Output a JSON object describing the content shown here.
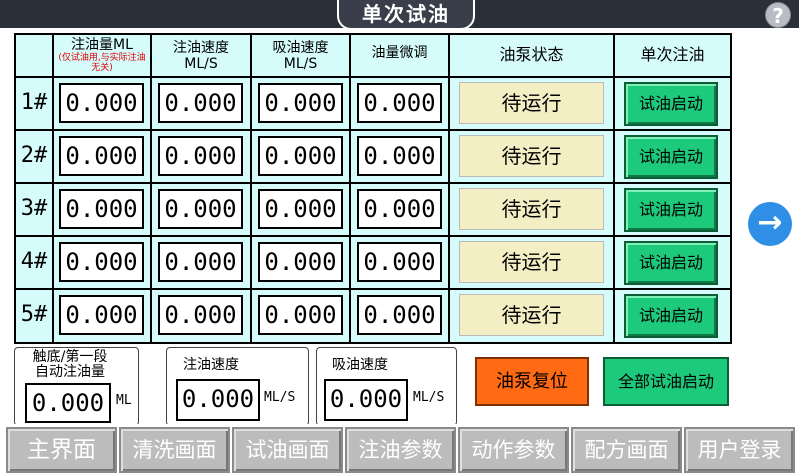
{
  "title": "单次试油",
  "help_label": "?",
  "headers": {
    "inject_amount": "注油量ML",
    "inject_amount_note": "(仅试油用,与实际注油无关)",
    "inject_speed": "注油速度",
    "inject_speed_unit": "ML/S",
    "suck_speed": "吸油速度",
    "suck_speed_unit": "ML/S",
    "fine_tune": "油量微调",
    "pump_status": "油泵状态",
    "single_inject": "单次注油"
  },
  "rows": [
    {
      "label": "1#",
      "amount": "0.000",
      "inject_speed": "0.000",
      "suck_speed": "0.000",
      "fine_tune": "0.000",
      "status": "待运行",
      "button": "试油启动"
    },
    {
      "label": "2#",
      "amount": "0.000",
      "inject_speed": "0.000",
      "suck_speed": "0.000",
      "fine_tune": "0.000",
      "status": "待运行",
      "button": "试油启动"
    },
    {
      "label": "3#",
      "amount": "0.000",
      "inject_speed": "0.000",
      "suck_speed": "0.000",
      "fine_tune": "0.000",
      "status": "待运行",
      "button": "试油启动"
    },
    {
      "label": "4#",
      "amount": "0.000",
      "inject_speed": "0.000",
      "suck_speed": "0.000",
      "fine_tune": "0.000",
      "status": "待运行",
      "button": "试油启动"
    },
    {
      "label": "5#",
      "amount": "0.000",
      "inject_speed": "0.000",
      "suck_speed": "0.000",
      "fine_tune": "0.000",
      "status": "待运行",
      "button": "试油启动"
    }
  ],
  "bottom": {
    "auto_amount_label": "触底/第一段\n自动注油量",
    "auto_amount_value": "0.000",
    "auto_amount_unit": "ML",
    "inject_speed_label": "注油速度",
    "inject_speed_value": "0.000",
    "inject_speed_unit": "ML/S",
    "suck_speed_label": "吸油速度",
    "suck_speed_value": "0.000",
    "suck_speed_unit": "ML/S",
    "pump_reset": "油泵复位",
    "all_start": "全部试油启动"
  },
  "nav": [
    "主界面",
    "清洗画面",
    "试油画面",
    "注油参数",
    "动作参数",
    "配方画面",
    "用户登录"
  ],
  "colors": {
    "start_button": "#1dc97a",
    "status_bg": "#f3eec4",
    "pump_reset": "#ff6a12",
    "grid_bg": "#d6fbfb",
    "nav_button": "#bcbcbc"
  },
  "icons": {
    "next": "arrow-right-icon",
    "help": "question-icon"
  }
}
